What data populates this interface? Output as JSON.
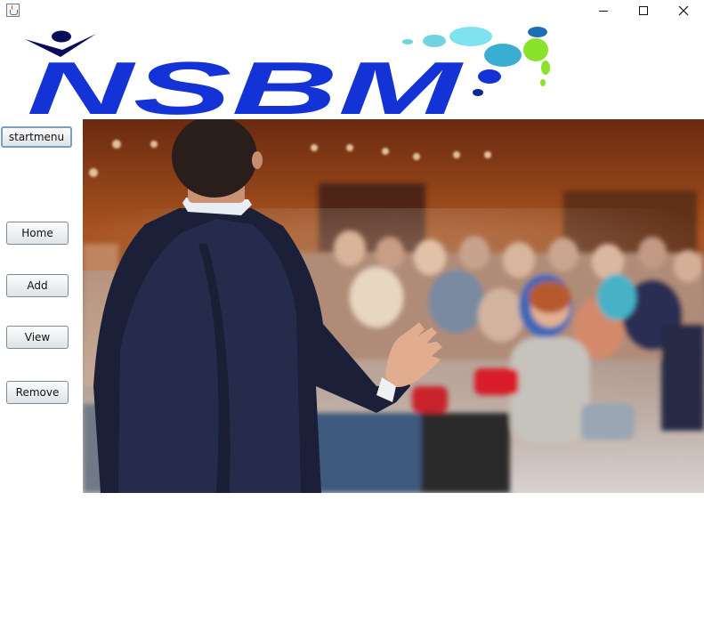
{
  "window": {
    "icon": "java-cup-icon",
    "controls": [
      "minimize-icon",
      "maximize-icon",
      "close-icon"
    ]
  },
  "logo": {
    "text": "NSBM",
    "colors": {
      "brand_blue": "#1433d6",
      "dark_navy": "#0b0b5c",
      "cyan": "#46c6d6",
      "lime": "#8be22a"
    }
  },
  "sidebar": {
    "startmenu_label": "startmenu",
    "buttons": [
      {
        "label": "Home"
      },
      {
        "label": "Add"
      },
      {
        "label": "View"
      },
      {
        "label": "Remove"
      }
    ]
  },
  "main": {
    "image": "conference-speaker-audience-photo"
  }
}
